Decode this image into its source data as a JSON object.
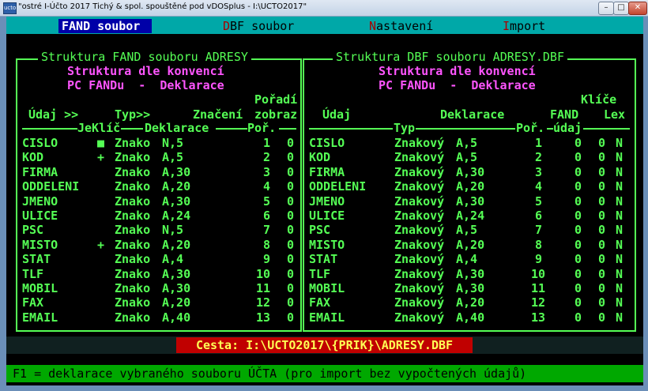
{
  "window": {
    "title": "\"ostré I-Účto 2017 Tichý & spol. spouštěné pod vDOSplus - I:\\UCTO2017\"",
    "app_icon_text": "ucto",
    "minimize_glyph": "–",
    "maximize_glyph": "□",
    "close_glyph": "✕"
  },
  "menu": [
    {
      "hotkey": "F",
      "rest": "AND soubor",
      "active": true
    },
    {
      "hotkey": "D",
      "rest": "BF soubor",
      "active": false
    },
    {
      "hotkey": "N",
      "rest": "astavení",
      "active": false
    },
    {
      "hotkey": "I",
      "rest": "mport",
      "active": false
    }
  ],
  "left_panel": {
    "title": "Struktura FAND souboru ADRESY",
    "subtitle1": "Struktura dle konvencí",
    "subtitle2": "PC FANDu  -  Deklarace",
    "header_row1": {
      "poradi": "Pořadí"
    },
    "header_row2": {
      "udaj": "Údaj >>",
      "typ": "Typ>>",
      "znaceni": "Značení",
      "zobraz": "zobraz"
    },
    "separator_labels": {
      "jeklic": "JeKlíč",
      "deklarace": "Deklarace",
      "por": "Poř."
    },
    "rows": [
      {
        "name": "CISLO",
        "key": "■",
        "type": "Znako",
        "decl": "N,5",
        "order": "1",
        "show": "0"
      },
      {
        "name": "KOD",
        "key": "+",
        "type": "Znako",
        "decl": "A,5",
        "order": "2",
        "show": "0"
      },
      {
        "name": "FIRMA",
        "key": "",
        "type": "Znako",
        "decl": "A,30",
        "order": "3",
        "show": "0"
      },
      {
        "name": "ODDELENI",
        "key": "",
        "type": "Znako",
        "decl": "A,20",
        "order": "4",
        "show": "0"
      },
      {
        "name": "JMENO",
        "key": "",
        "type": "Znako",
        "decl": "A,30",
        "order": "5",
        "show": "0"
      },
      {
        "name": "ULICE",
        "key": "",
        "type": "Znako",
        "decl": "A,24",
        "order": "6",
        "show": "0"
      },
      {
        "name": "PSC",
        "key": "",
        "type": "Znako",
        "decl": "N,5",
        "order": "7",
        "show": "0"
      },
      {
        "name": "MISTO",
        "key": "+",
        "type": "Znako",
        "decl": "A,20",
        "order": "8",
        "show": "0"
      },
      {
        "name": "STAT",
        "key": "",
        "type": "Znako",
        "decl": "A,4",
        "order": "9",
        "show": "0"
      },
      {
        "name": "TLF",
        "key": "",
        "type": "Znako",
        "decl": "A,30",
        "order": "10",
        "show": "0"
      },
      {
        "name": "MOBIL",
        "key": "",
        "type": "Znako",
        "decl": "A,30",
        "order": "11",
        "show": "0"
      },
      {
        "name": "FAX",
        "key": "",
        "type": "Znako",
        "decl": "A,20",
        "order": "12",
        "show": "0"
      },
      {
        "name": "EMAIL",
        "key": "",
        "type": "Znako",
        "decl": "A,40",
        "order": "13",
        "show": "0"
      }
    ]
  },
  "right_panel": {
    "title": "Struktura DBF souboru ADRESY.DBF",
    "subtitle1": "Struktura dle konvencí",
    "subtitle2": "PC FANDu  -  Deklarace",
    "header_row1": {
      "klice": "Klíče"
    },
    "header_row2": {
      "udaj": "Údaj",
      "deklarace": "Deklarace",
      "fand": "FAND",
      "lex": "Lex"
    },
    "separator_labels": {
      "typ": "Typ",
      "por": "Poř.",
      "udaj": "údaj"
    },
    "rows": [
      {
        "name": "CISLO",
        "type": "Znakový",
        "decl": "A,5",
        "order": "1",
        "fand": "0",
        "key": "0",
        "lex": "N"
      },
      {
        "name": "KOD",
        "type": "Znakový",
        "decl": "A,5",
        "order": "2",
        "fand": "0",
        "key": "0",
        "lex": "N"
      },
      {
        "name": "FIRMA",
        "type": "Znakový",
        "decl": "A,30",
        "order": "3",
        "fand": "0",
        "key": "0",
        "lex": "N"
      },
      {
        "name": "ODDELENI",
        "type": "Znakový",
        "decl": "A,20",
        "order": "4",
        "fand": "0",
        "key": "0",
        "lex": "N"
      },
      {
        "name": "JMENO",
        "type": "Znakový",
        "decl": "A,30",
        "order": "5",
        "fand": "0",
        "key": "0",
        "lex": "N"
      },
      {
        "name": "ULICE",
        "type": "Znakový",
        "decl": "A,24",
        "order": "6",
        "fand": "0",
        "key": "0",
        "lex": "N"
      },
      {
        "name": "PSC",
        "type": "Znakový",
        "decl": "A,5",
        "order": "7",
        "fand": "0",
        "key": "0",
        "lex": "N"
      },
      {
        "name": "MISTO",
        "type": "Znakový",
        "decl": "A,20",
        "order": "8",
        "fand": "0",
        "key": "0",
        "lex": "N"
      },
      {
        "name": "STAT",
        "type": "Znakový",
        "decl": "A,4",
        "order": "9",
        "fand": "0",
        "key": "0",
        "lex": "N"
      },
      {
        "name": "TLF",
        "type": "Znakový",
        "decl": "A,30",
        "order": "10",
        "fand": "0",
        "key": "0",
        "lex": "N"
      },
      {
        "name": "MOBIL",
        "type": "Znakový",
        "decl": "A,30",
        "order": "11",
        "fand": "0",
        "key": "0",
        "lex": "N"
      },
      {
        "name": "FAX",
        "type": "Znakový",
        "decl": "A,20",
        "order": "12",
        "fand": "0",
        "key": "0",
        "lex": "N"
      },
      {
        "name": "EMAIL",
        "type": "Znakový",
        "decl": "A,40",
        "order": "13",
        "fand": "0",
        "key": "0",
        "lex": "N"
      }
    ]
  },
  "path_label": "Cesta: I:\\UCTO2017\\{PRIK}\\ADRESY.DBF",
  "status_text": "F1 = deklarace vybraného souboru ÚČTA (pro import bez vypočtených údajů)",
  "colors": {
    "foreground": "#55ff55",
    "accent": "#ff55ff",
    "menu_bg": "#00a8a8",
    "menu_active": "#0000a8",
    "path_bg": "#c00000",
    "status_bg": "#00a800"
  }
}
